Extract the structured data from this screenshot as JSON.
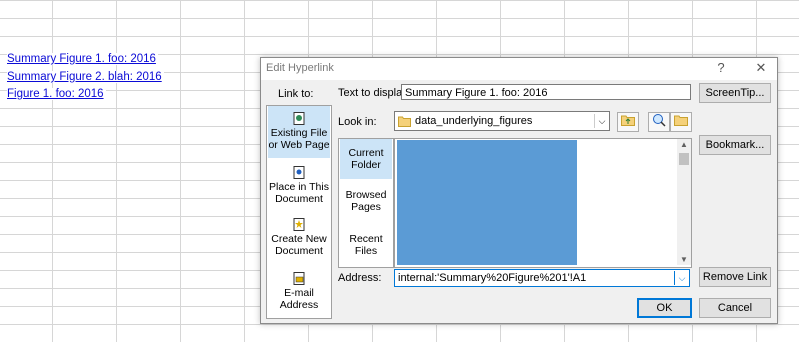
{
  "sheet": {
    "links": [
      "Summary Figure 1. foo: 2016",
      "Summary Figure 2. blah: 2016",
      "Figure 1. foo: 2016"
    ]
  },
  "dialog": {
    "title": "Edit Hyperlink",
    "help_glyph": "?",
    "close_glyph": "✕",
    "link_to_label": "Link to:",
    "text_to_display_label": "Text to display:",
    "text_to_display_value": "Summary Figure 1. foo: 2016",
    "screentip_button": "ScreenTip...",
    "link_to_items": [
      {
        "label_line1": "Existing File",
        "label_line2": "or Web Page"
      },
      {
        "label_line1": "Place in This",
        "label_line2": "Document"
      },
      {
        "label_line1": "Create New",
        "label_line2": "Document"
      },
      {
        "label_line1": "E-mail",
        "label_line2": "Address"
      }
    ],
    "look_in_label": "Look in:",
    "look_in_value": "data_underlying_figures",
    "browse_items": [
      {
        "line1": "Current",
        "line2": "Folder"
      },
      {
        "line1": "Browsed",
        "line2": "Pages"
      },
      {
        "line1": "Recent",
        "line2": "Files"
      }
    ],
    "bookmark_button": "Bookmark...",
    "address_label": "Address:",
    "address_value": "internal:'Summary%20Figure%201'!A1",
    "remove_link_button": "Remove Link",
    "ok_button": "OK",
    "cancel_button": "Cancel",
    "accent_color": "#0078d7",
    "selected_bg": "#cce4f7",
    "redaction_color": "#5b9bd5"
  }
}
